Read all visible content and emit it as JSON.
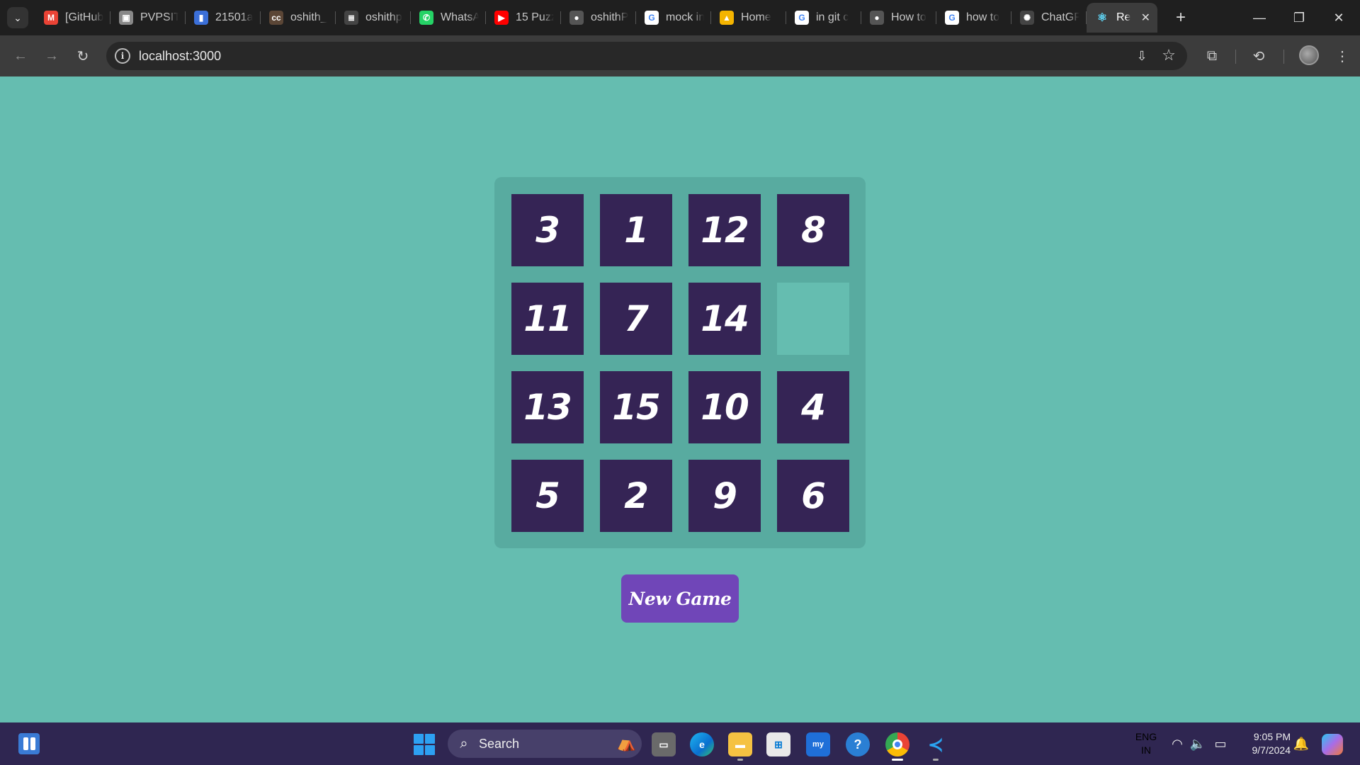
{
  "browser": {
    "tabs": [
      {
        "icon": "gmail-icon",
        "label": "[GitHub",
        "color": "#ea4335",
        "glyph": "M"
      },
      {
        "icon": "pvpsit-icon",
        "label": "PVPSIT",
        "color": "#888888",
        "glyph": "▣"
      },
      {
        "icon": "analytics-icon",
        "label": "21501a",
        "color": "#3b6fd8",
        "glyph": "▮"
      },
      {
        "icon": "codechef-icon",
        "label": "oshith_",
        "color": "#5b4636",
        "glyph": "cc"
      },
      {
        "icon": "hackerrank-icon",
        "label": "oshithp",
        "color": "#444444",
        "glyph": "≣"
      },
      {
        "icon": "whatsapp-icon",
        "label": "WhatsA",
        "color": "#25d366",
        "glyph": "✆"
      },
      {
        "icon": "youtube-icon",
        "label": "15 Puzz",
        "color": "#ff0000",
        "glyph": "▶"
      },
      {
        "icon": "github-icon",
        "label": "oshithP",
        "color": "#555555",
        "glyph": "●"
      },
      {
        "icon": "google-icon",
        "label": "mock in",
        "color": "#ffffff",
        "glyph": "G"
      },
      {
        "icon": "google-drive-icon",
        "label": "Home",
        "color": "#f4b400",
        "glyph": "▲"
      },
      {
        "icon": "google-icon",
        "label": "in git c",
        "color": "#ffffff",
        "glyph": "G"
      },
      {
        "icon": "github-icon",
        "label": "How to",
        "color": "#555555",
        "glyph": "●"
      },
      {
        "icon": "google-icon",
        "label": "how to",
        "color": "#ffffff",
        "glyph": "G"
      },
      {
        "icon": "chatgpt-icon",
        "label": "ChatGP",
        "color": "#444444",
        "glyph": "✺"
      }
    ],
    "active_tab": {
      "icon": "react-icon",
      "label": "Re",
      "close": "✕"
    },
    "url": "localhost:3000"
  },
  "game": {
    "tiles": [
      "3",
      "1",
      "12",
      "8",
      "11",
      "7",
      "14",
      "",
      "13",
      "15",
      "10",
      "4",
      "5",
      "2",
      "9",
      "6"
    ],
    "new_game_label": "New Game"
  },
  "taskbar": {
    "search_label": "Search",
    "language": "ENG",
    "region": "IN",
    "time": "9:05 PM",
    "date": "9/7/2024"
  },
  "colors": {
    "page_background": "#65bdb0",
    "board": "#58aba0",
    "tile": "#352455",
    "button": "#7046b8"
  }
}
